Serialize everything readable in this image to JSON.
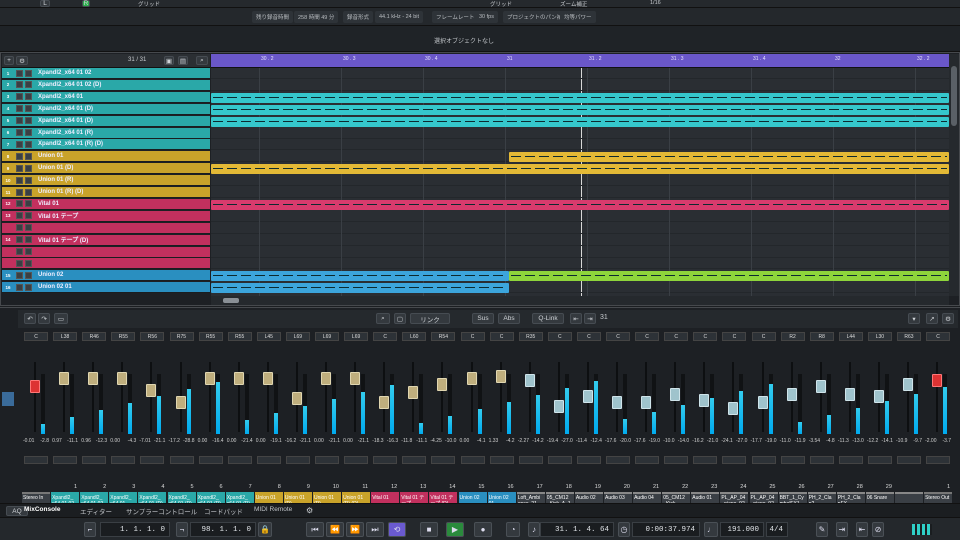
{
  "infobar": {
    "max_time_label": "残り録音時間",
    "max_time_value": "258 時間 49 分",
    "format_label": "録音形式",
    "format_value": "44.1 kHz - 24 bit",
    "frame_label": "フレームレート",
    "frame_value": "30 fps",
    "pan_label": "プロジェクトのパン補正",
    "pan_value": "均等パワー"
  },
  "topbar": {
    "snap_label": "グリッド",
    "quantize_label": "1/16",
    "zoom_label": "ズーム補正"
  },
  "selection_text": "選択オブジェクトなし",
  "tracklist": {
    "count": "31 / 31"
  },
  "tracks": [
    {
      "num": "1",
      "name": "Xpandl2_x64 01 02",
      "color": "#2aa8a8"
    },
    {
      "num": "2",
      "name": "Xpandl2_x64 01 02 (D)",
      "color": "#2aa8a8"
    },
    {
      "num": "3",
      "name": "Xpandl2_x64 01",
      "color": "#2aa8a8"
    },
    {
      "num": "4",
      "name": "Xpandl2_x64 01 (D)",
      "color": "#2aa8a8"
    },
    {
      "num": "5",
      "name": "Xpandl2_x64 01 (D)",
      "color": "#2aa8a8"
    },
    {
      "num": "6",
      "name": "Xpandl2_x64 01 (R)",
      "color": "#2aa8a8"
    },
    {
      "num": "7",
      "name": "Xpandl2_x64 01 (R) (D)",
      "color": "#2aa8a8"
    },
    {
      "num": "8",
      "name": "Union 01",
      "color": "#c9a32a"
    },
    {
      "num": "9",
      "name": "Union 01 (D)",
      "color": "#c9a32a"
    },
    {
      "num": "10",
      "name": "Union 01 (R)",
      "color": "#c9a32a"
    },
    {
      "num": "11",
      "name": "Union 01 (R) (D)",
      "color": "#c9a32a"
    },
    {
      "num": "12",
      "name": "Vital 01",
      "color": "#c2305e"
    },
    {
      "num": "13",
      "name": "Vital 01 テープ",
      "color": "#c2305e"
    },
    {
      "num": "",
      "name": "",
      "color": "#c2305e"
    },
    {
      "num": "14",
      "name": "Vital 01 テープ (D)",
      "color": "#c2305e"
    },
    {
      "num": "",
      "name": "",
      "color": "#c2305e"
    },
    {
      "num": "",
      "name": "",
      "color": "#c2305e"
    },
    {
      "num": "15",
      "name": "Union 02",
      "color": "#2a8fc0"
    },
    {
      "num": "16",
      "name": "Union 02 01",
      "color": "#2a8fc0"
    }
  ],
  "ruler": [
    "30 . 2",
    "30 . 3",
    "30 . 4",
    "31",
    "31 . 2",
    "31 . 3",
    "31 . 4",
    "32",
    "32 . 2"
  ],
  "mixer": {
    "toolbar": {
      "link_label": "リンク",
      "sus_label": "Sus",
      "abs_label": "Abs",
      "qlink_label": "Q-Link",
      "channel_num": "31"
    },
    "strips": [
      {
        "pan": "C",
        "num": "",
        "name": "Stereo In",
        "vol": "-0.01",
        "peak": "-2.8",
        "color": "#777"
      },
      {
        "pan": "L38",
        "num": "1",
        "name": "Xpandl2_ x64 01 02",
        "vol": "0.97",
        "peak": "-11.1",
        "color": "#2aa8a8"
      },
      {
        "pan": "R46",
        "num": "2",
        "name": "Xpandl2_ x64 01 02",
        "vol": "0.96",
        "peak": "-12.3",
        "color": "#2aa8a8"
      },
      {
        "pan": "R55",
        "num": "3",
        "name": "Xpandl2_ x64 01",
        "vol": "0.00",
        "peak": "-4.3",
        "color": "#2aa8a8"
      },
      {
        "pan": "R56",
        "num": "4",
        "name": "Xpandl2_ x64 01 (D)",
        "vol": "-7.01",
        "peak": "-21.1",
        "color": "#2aa8a8"
      },
      {
        "pan": "R75",
        "num": "5",
        "name": "Xpandl2_ x64 01 (D)",
        "vol": "-17.2",
        "peak": "-28.8",
        "color": "#2aa8a8"
      },
      {
        "pan": "R55",
        "num": "6",
        "name": "Xpandl2_ x64 01 (R)",
        "vol": "0.00",
        "peak": "-16.4",
        "color": "#2aa8a8"
      },
      {
        "pan": "R55",
        "num": "7",
        "name": "Xpandl2_ x64 01 (R)",
        "vol": "0.00",
        "peak": "-21.4",
        "color": "#2aa8a8"
      },
      {
        "pan": "L45",
        "num": "8",
        "name": "Union 01",
        "vol": "0.00",
        "peak": "-19.1",
        "color": "#c9a32a"
      },
      {
        "pan": "L69",
        "num": "9",
        "name": "Union 01 (D)",
        "vol": "-16.2",
        "peak": "-21.1",
        "color": "#c9a32a"
      },
      {
        "pan": "L69",
        "num": "10",
        "name": "Union 01 (R)",
        "vol": "0.00",
        "peak": "-21.1",
        "color": "#c9a32a"
      },
      {
        "pan": "L69",
        "num": "11",
        "name": "Union 01 (R) (D)",
        "vol": "0.00",
        "peak": "-21.1",
        "color": "#c9a32a"
      },
      {
        "pan": "C",
        "num": "12",
        "name": "Vital 01",
        "vol": "-18.3",
        "peak": "-16.3",
        "color": "#c2305e"
      },
      {
        "pan": "L60",
        "num": "13",
        "name": "Vital 01 テープ",
        "vol": "-11.8",
        "peak": "-11.1",
        "color": "#c2305e"
      },
      {
        "pan": "R54",
        "num": "14",
        "name": "Vital 01 テープ (D)",
        "vol": "-4.25",
        "peak": "-10.0",
        "color": "#c2305e"
      },
      {
        "pan": "C",
        "num": "15",
        "name": "Union 02",
        "vol": "0.00",
        "peak": "-4.1",
        "color": "#2a8fc0"
      },
      {
        "pan": "C",
        "num": "16",
        "name": "Union 02 01",
        "vol": "1.33",
        "peak": "-4.2",
        "color": "#2a8fc0"
      },
      {
        "pan": "R35",
        "num": "17",
        "name": "Loft_Ambi ence_21_",
        "vol": "-2.27",
        "peak": "-14.2",
        "color": "#888"
      },
      {
        "pan": "C",
        "num": "18",
        "name": "05_CM12 _Kick_A_1",
        "vol": "-19.4",
        "peak": "-27.0",
        "color": "#888"
      },
      {
        "pan": "C",
        "num": "19",
        "name": "Audio 02",
        "vol": "-11.4",
        "peak": "-12.4",
        "color": "#888"
      },
      {
        "pan": "C",
        "num": "20",
        "name": "Audio 03",
        "vol": "-17.6",
        "peak": "-20.0",
        "color": "#888"
      },
      {
        "pan": "C",
        "num": "21",
        "name": "Audio 04",
        "vol": "-17.6",
        "peak": "-19.0",
        "color": "#888"
      },
      {
        "pan": "C",
        "num": "22",
        "name": "05_CM12 _Kick",
        "vol": "-10.0",
        "peak": "-14.0",
        "color": "#888"
      },
      {
        "pan": "C",
        "num": "23",
        "name": "Audio 01",
        "vol": "-16.2",
        "peak": "-21.0",
        "color": "#888"
      },
      {
        "pan": "C",
        "num": "24",
        "name": "PL_AP_04 _piano_92",
        "vol": "-24.1",
        "peak": "-27.0",
        "color": "#888"
      },
      {
        "pan": "C",
        "num": "25",
        "name": "PL_AP_04 _piano_92",
        "vol": "-17.7",
        "peak": "-19.0",
        "color": "#888"
      },
      {
        "pan": "R2",
        "num": "26",
        "name": "BBT_1_Cy mbalFX1",
        "vol": "-11.0",
        "peak": "-11.9",
        "color": "#888"
      },
      {
        "pan": "R8",
        "num": "27",
        "name": "PH_2_Cla p2",
        "vol": "-3.54",
        "peak": "-4.8",
        "color": "#888"
      },
      {
        "pan": "L44",
        "num": "28",
        "name": "PH_2_Cla pFX",
        "vol": "-11.3",
        "peak": "-13.0",
        "color": "#888"
      },
      {
        "pan": "L30",
        "num": "29",
        "name": "06 Snare",
        "vol": "-12.2",
        "peak": "-14.1",
        "color": "#888"
      },
      {
        "pan": "R63",
        "num": "",
        "name": "",
        "vol": "-10.9",
        "peak": "-9.7",
        "color": "#888"
      },
      {
        "pan": "C",
        "num": "1",
        "name": "Stereo Out",
        "vol": "-2.00",
        "peak": "-3.7",
        "color": "#777"
      }
    ]
  },
  "tabs": [
    "MixConsole",
    "エディター",
    "サンプラーコントロール",
    "コードパッド",
    "MIDI Remote"
  ],
  "transport": {
    "left_locator": "1. 1. 1. 0",
    "right_locator": "98. 1. 1. 0",
    "position": "31. 1. 4. 64",
    "time": "0:00:37.974",
    "tempo": "191.000",
    "signature": "4/4"
  }
}
